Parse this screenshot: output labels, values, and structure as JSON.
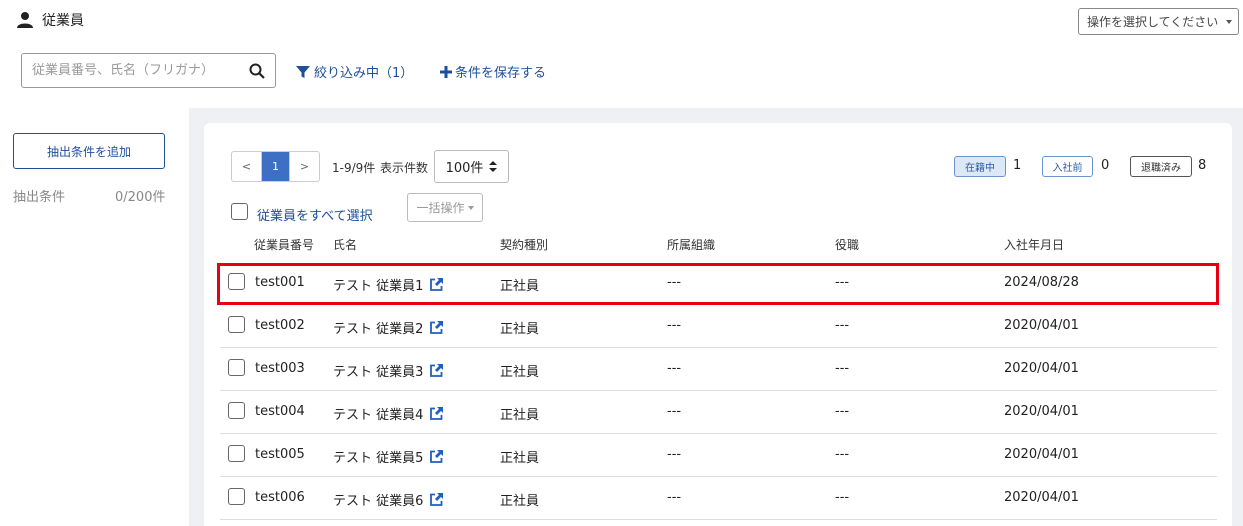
{
  "header": {
    "title": "従業員",
    "operations_select": "操作を選択してください"
  },
  "search": {
    "placeholder": "従業員番号、氏名（フリガナ）",
    "value": ""
  },
  "toolbar": {
    "filter_label": "絞り込み中（1）",
    "save_label": "条件を保存する"
  },
  "left_panel": {
    "add_condition_label": "抽出条件を追加",
    "conditions_label": "抽出条件",
    "conditions_count": "0/200件"
  },
  "pager": {
    "prev": "<",
    "current": "1",
    "next": ">",
    "range": "1-9/9件",
    "per_page_label": "表示件数",
    "per_page_value": "100件"
  },
  "status": [
    {
      "label": "在籍中",
      "count": "1"
    },
    {
      "label": "入社前",
      "count": "0"
    },
    {
      "label": "退職済み",
      "count": "8"
    }
  ],
  "bulk": {
    "select_all_label": "従業員をすべて選択",
    "bulk_action_label": "一括操作"
  },
  "table": {
    "headers": [
      "従業員番号",
      "氏名",
      "契約種別",
      "所属組織",
      "役職",
      "入社年月日"
    ],
    "rows": [
      {
        "id": "test001",
        "name": "テスト 従業員1",
        "type": "正社員",
        "org": "---",
        "role": "---",
        "date": "2024/08/28"
      },
      {
        "id": "test002",
        "name": "テスト 従業員2",
        "type": "正社員",
        "org": "---",
        "role": "---",
        "date": "2020/04/01"
      },
      {
        "id": "test003",
        "name": "テスト 従業員3",
        "type": "正社員",
        "org": "---",
        "role": "---",
        "date": "2020/04/01"
      },
      {
        "id": "test004",
        "name": "テスト 従業員4",
        "type": "正社員",
        "org": "---",
        "role": "---",
        "date": "2020/04/01"
      },
      {
        "id": "test005",
        "name": "テスト 従業員5",
        "type": "正社員",
        "org": "---",
        "role": "---",
        "date": "2020/04/01"
      },
      {
        "id": "test006",
        "name": "テスト 従業員6",
        "type": "正社員",
        "org": "---",
        "role": "---",
        "date": "2020/04/01"
      }
    ]
  },
  "colors": {
    "accent": "#1f4e9a",
    "highlight": "#e60012",
    "pager_active": "#3d6fc4"
  },
  "icons": {
    "header": "person-icon",
    "search": "search-icon",
    "filter": "filter-icon",
    "save": "plus-icon",
    "row_link": "external-link-icon"
  }
}
